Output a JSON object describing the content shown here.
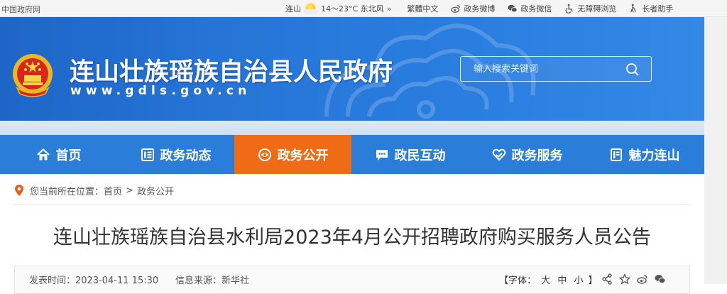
{
  "topbar": {
    "site_name": "中国政府网",
    "weather_city": "连山",
    "weather_icon": "sunny-icon",
    "weather_info": "14～23°C 东北风",
    "more_arrows": "»",
    "links": [
      {
        "label": "繁體中文",
        "icon": "traditional-icon"
      },
      {
        "label": "政务微博",
        "icon": "weibo-icon"
      },
      {
        "label": "政务微信",
        "icon": "wechat-icon"
      },
      {
        "label": "无障碍浏览",
        "icon": "accessibility-icon"
      },
      {
        "label": "长者助手",
        "icon": "elder-icon"
      }
    ]
  },
  "header": {
    "title": "连山壮族瑶族自治县人民政府",
    "url": "www.gdls.gov.cn",
    "search_placeholder": "输入搜索关键词"
  },
  "nav": {
    "items": [
      {
        "label": "首页",
        "icon": "home-icon"
      },
      {
        "label": "政务动态",
        "icon": "news-icon"
      },
      {
        "label": "政务公开",
        "icon": "eye-icon"
      },
      {
        "label": "政民互动",
        "icon": "chat-icon"
      },
      {
        "label": "政务服务",
        "icon": "heart-hand-icon"
      },
      {
        "label": "魅力连山",
        "icon": "book-icon"
      }
    ],
    "active_index": 2
  },
  "breadcrumb": {
    "prefix": "您当前所在位置：",
    "home": "首页",
    "separator": ">",
    "current": "政务公开"
  },
  "article": {
    "title": "连山壮族瑶族自治县水利局2023年4月公开招聘政府购买服务人员公告",
    "publish_label": "发表时间：",
    "publish_time": "2023-04-11 15:30",
    "source_label": "信息来源：",
    "source": "新华社",
    "font_prefix": "【字体：",
    "font_large": "大",
    "font_medium": "中",
    "font_small": "小",
    "font_suffix": "】"
  },
  "colors": {
    "banner_blue": "#2676d8",
    "nav_blue": "#2a7ed9",
    "nav_active": "#ef6b15"
  }
}
